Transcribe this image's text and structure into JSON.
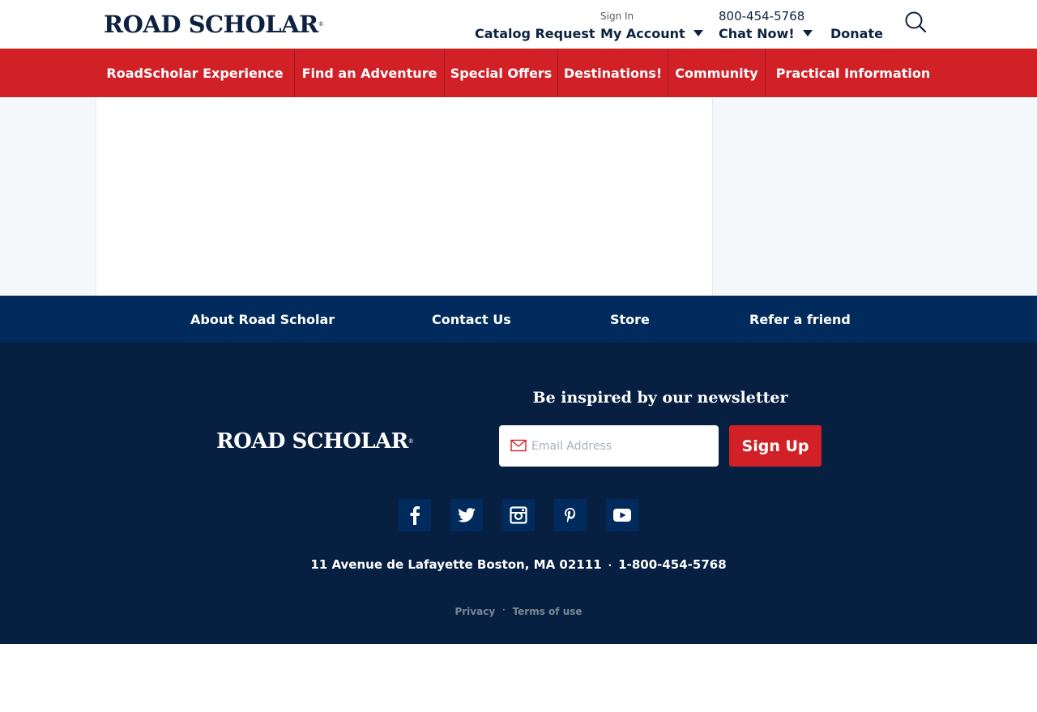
{
  "header": {
    "logo_text": "ROAD SCHOLAR",
    "catalog_request": "Catalog Request",
    "sign_in": "Sign In",
    "my_account": "My Account",
    "phone": "800-454-5768",
    "chat_now": "Chat Now!",
    "donate": "Donate"
  },
  "nav": {
    "items": [
      {
        "label": "RoadScholar Experience"
      },
      {
        "label": "Find an Adventure"
      },
      {
        "label": "Special Offers"
      },
      {
        "label": "Destinations!"
      },
      {
        "label": "Community"
      },
      {
        "label": "Practical Information"
      }
    ]
  },
  "footer_links": {
    "items": [
      {
        "label": "About Road Scholar"
      },
      {
        "label": "Contact Us"
      },
      {
        "label": "Store"
      },
      {
        "label": "Refer a friend"
      }
    ]
  },
  "footer": {
    "logo_text": "ROAD SCHOLAR",
    "newsletter_title": "Be inspired by our newsletter",
    "email_placeholder": "Email Address",
    "signup_label": "Sign Up",
    "social": [
      "facebook-icon",
      "twitter-icon",
      "instagram-icon",
      "pinterest-icon",
      "youtube-icon"
    ],
    "address": "11 Avenue de Lafayette Boston, MA 02111",
    "separator": "·",
    "phone": "1-800-454-5768",
    "privacy": "Privacy",
    "terms": "Terms of use"
  },
  "colors": {
    "brand_red": "#d22027",
    "navy": "#002b5c",
    "footer_dark": "#071f40"
  }
}
